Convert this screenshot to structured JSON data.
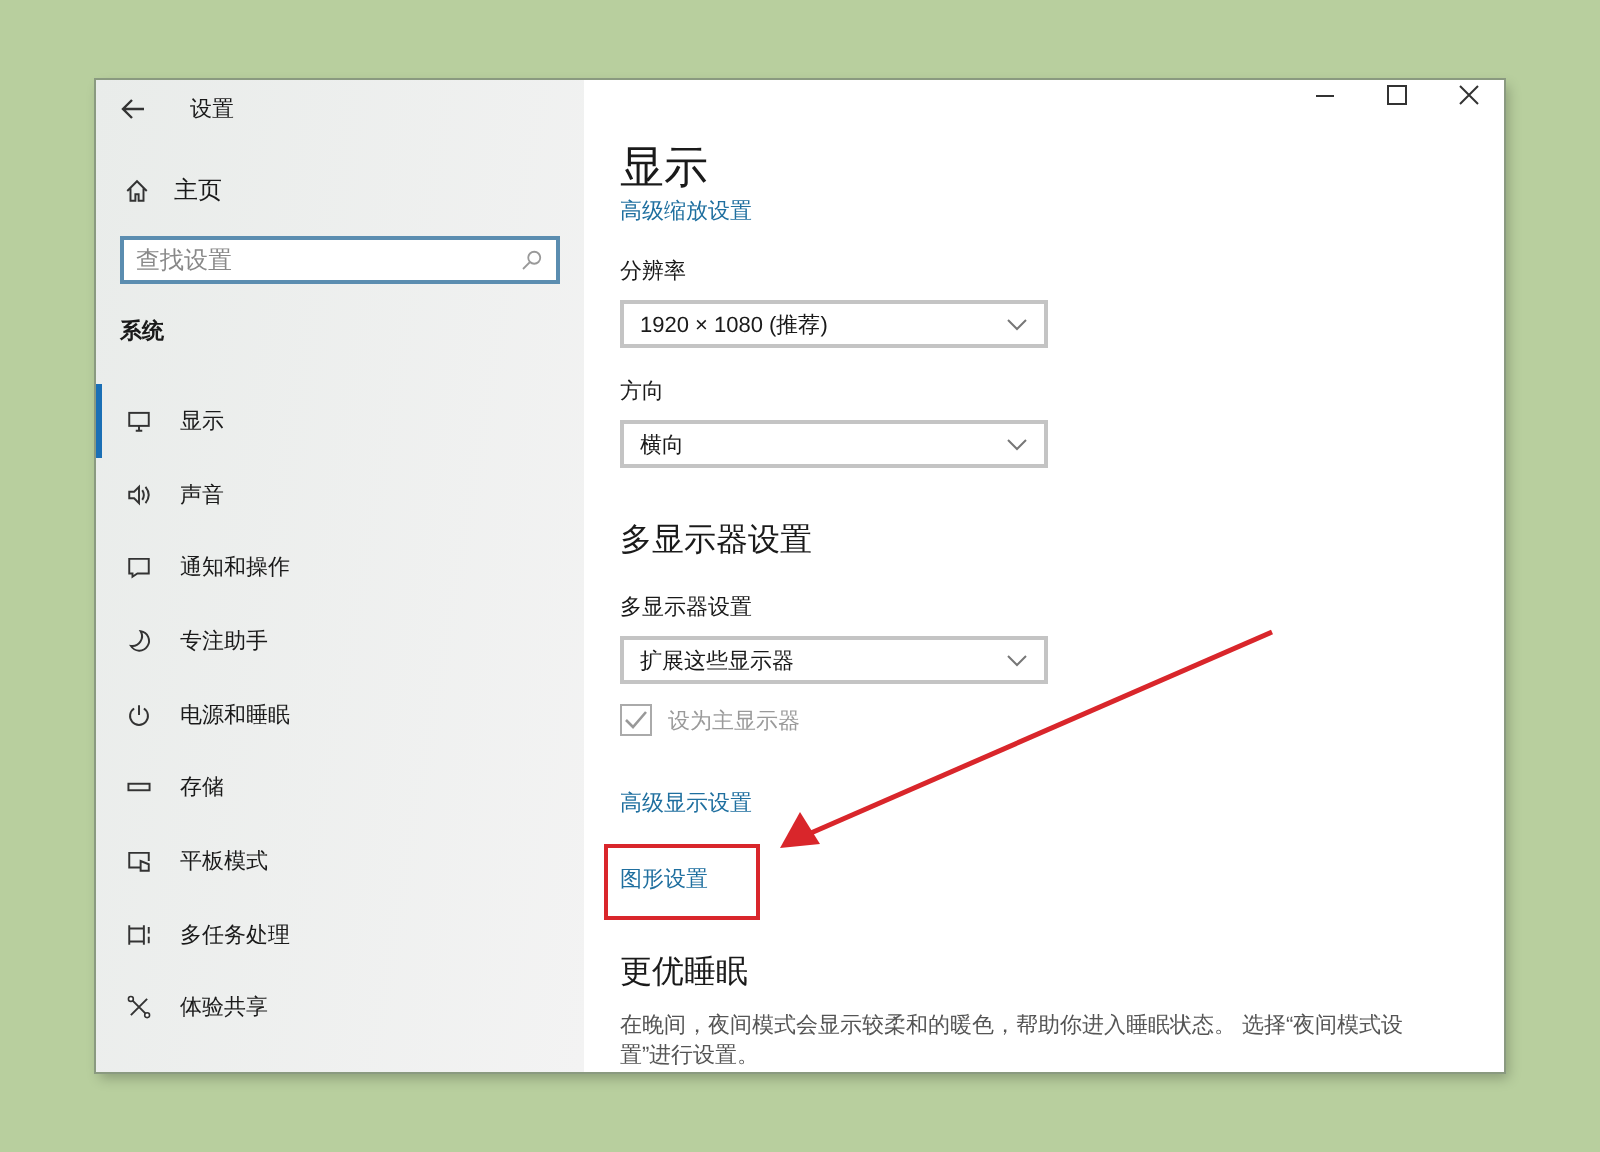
{
  "window": {
    "title": "设置"
  },
  "sidebar": {
    "home": "主页",
    "search": {
      "placeholder": "查找设置"
    },
    "section": "系统",
    "items": [
      {
        "label": "显示",
        "selected": true
      },
      {
        "label": "声音",
        "selected": false
      },
      {
        "label": "通知和操作",
        "selected": false
      },
      {
        "label": "专注助手",
        "selected": false
      },
      {
        "label": "电源和睡眠",
        "selected": false
      },
      {
        "label": "存储",
        "selected": false
      },
      {
        "label": "平板模式",
        "selected": false
      },
      {
        "label": "多任务处理",
        "selected": false
      },
      {
        "label": "体验共享",
        "selected": false
      }
    ]
  },
  "content": {
    "title": "显示",
    "scale_link": "高级缩放设置",
    "resolution": {
      "label": "分辨率",
      "value": "1920 × 1080 (推荐)"
    },
    "orientation": {
      "label": "方向",
      "value": "横向"
    },
    "multi_heading": "多显示器设置",
    "multi_display": {
      "label": "多显示器设置",
      "value": "扩展这些显示器"
    },
    "main_display": {
      "label": "设为主显示器",
      "checked": true,
      "disabled": true
    },
    "advanced_link": "高级显示设置",
    "graphics_link": {
      "label": "图形设置",
      "highlighted": true
    },
    "sleep_heading": "更优睡眠",
    "sleep_text": "在晚间，夜间模式会显示较柔和的暖色，帮助你进入睡眠状态。 选择“夜间模式设置”进行设置。"
  }
}
